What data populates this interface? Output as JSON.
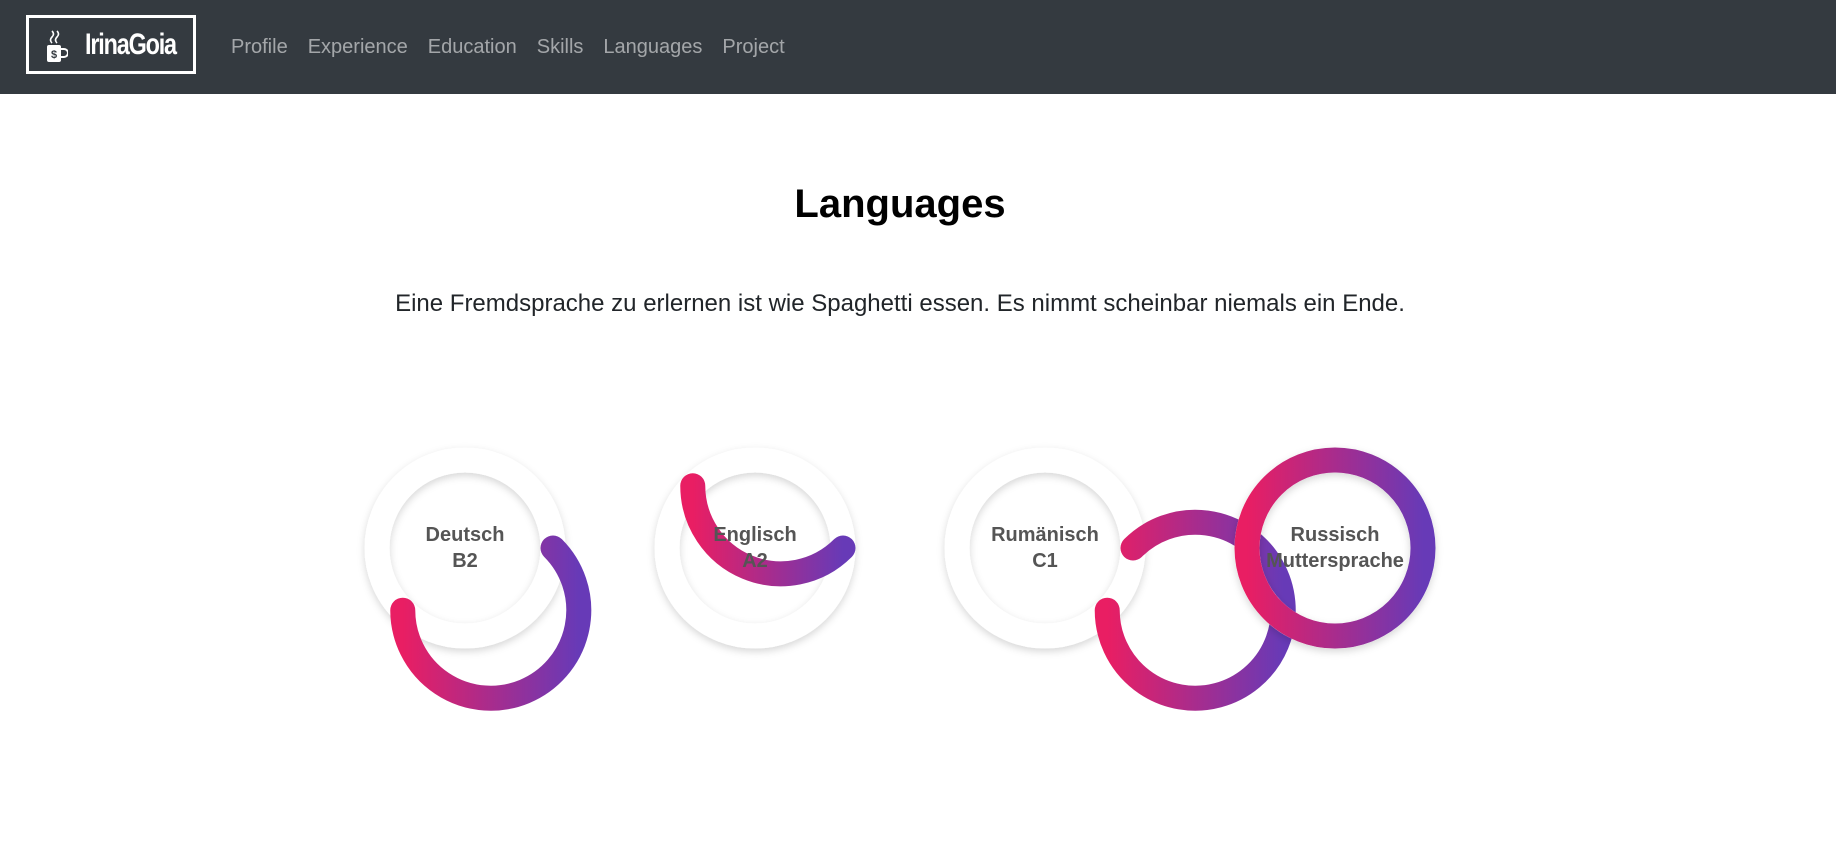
{
  "brand": {
    "name": "IrinaGoia",
    "icon": "coffee-mug-icon"
  },
  "nav": {
    "items": [
      {
        "label": "Profile"
      },
      {
        "label": "Experience"
      },
      {
        "label": "Education"
      },
      {
        "label": "Skills"
      },
      {
        "label": "Languages"
      },
      {
        "label": "Project"
      }
    ]
  },
  "colors": {
    "navbar": "#343a40",
    "gradient_start": "#e91e63",
    "gradient_end": "#673ab7",
    "label": "#555555"
  },
  "section": {
    "title": "Languages",
    "quote": "Eine Fremdsprache zu erlernen ist wie Spaghetti essen. Es nimmt scheinbar niemals ein Ende."
  },
  "languages": [
    {
      "name": "Deutsch",
      "level": "B2",
      "progress": 0.625
    },
    {
      "name": "Englisch",
      "level": "A2",
      "progress": 0.375
    },
    {
      "name": "Rumänisch",
      "level": "C1",
      "progress": 0.875
    },
    {
      "name": "Russisch",
      "level": "Muttersprache",
      "progress": 1.0
    }
  ]
}
